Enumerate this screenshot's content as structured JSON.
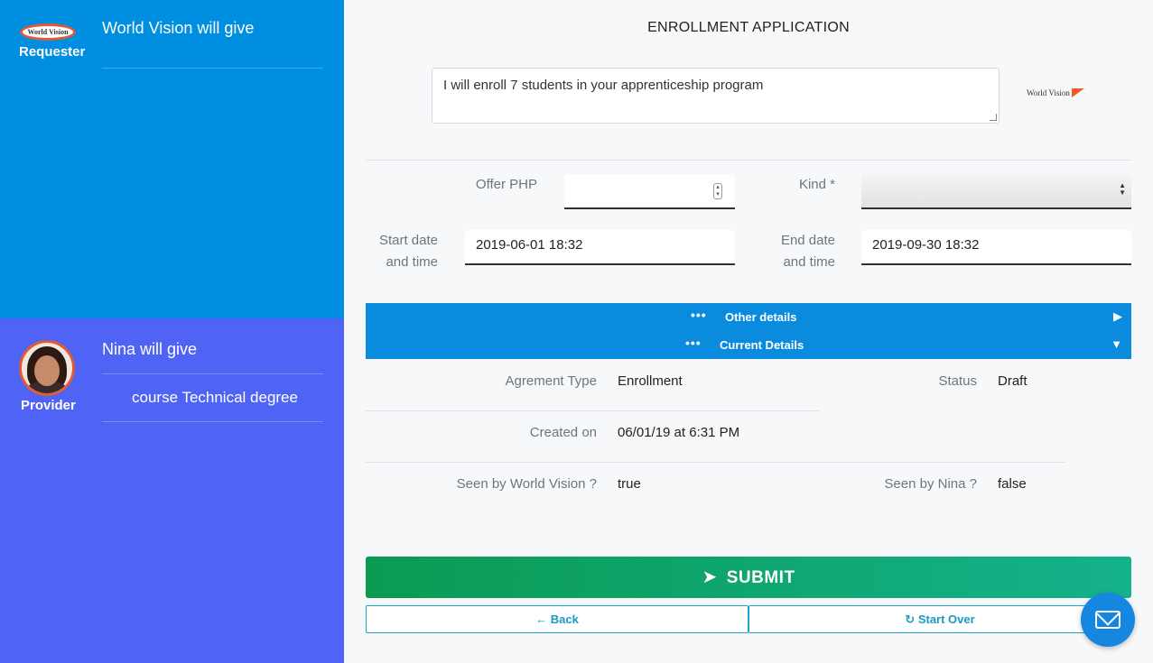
{
  "requester": {
    "logo_text": "World Vision",
    "role_label": "Requester",
    "title": "World Vision will give"
  },
  "provider": {
    "role_label": "Provider",
    "title": "Nina will give",
    "item": "course  Technical degree"
  },
  "form": {
    "title": "ENROLLMENT APPLICATION",
    "message": "I will enroll 7 students in your apprenticeship program",
    "partner_logo_text": "World Vision",
    "offer_label": "Offer PHP",
    "offer_value": "",
    "kind_label": "Kind *",
    "kind_value": "",
    "start_label_1": "Start date",
    "start_label_2": "and time",
    "start_value": "2019-06-01 18:32",
    "end_label_1": "End date",
    "end_label_2": "and time",
    "end_value": "2019-09-30 18:32"
  },
  "sections": {
    "other_details": "Other details",
    "current_details": "Current Details"
  },
  "details": {
    "agreement_type_label": "Agrement Type",
    "agreement_type_value": "Enrollment",
    "status_label": "Status",
    "status_value": "Draft",
    "created_label": "Created on",
    "created_value": "06/01/19 at 6:31 PM",
    "seen_requester_label": "Seen by World Vision ?",
    "seen_requester_value": "true",
    "seen_provider_label": "Seen by Nina ?",
    "seen_provider_value": "false"
  },
  "actions": {
    "submit": "SUBMIT",
    "back": "Back",
    "start_over": "Start Over"
  },
  "colors": {
    "requester_panel": "#008ee0",
    "provider_panel": "#4f64f4",
    "accent_bar": "#0a8bde",
    "submit_start": "#0a9a52",
    "submit_end": "#14b28c"
  }
}
